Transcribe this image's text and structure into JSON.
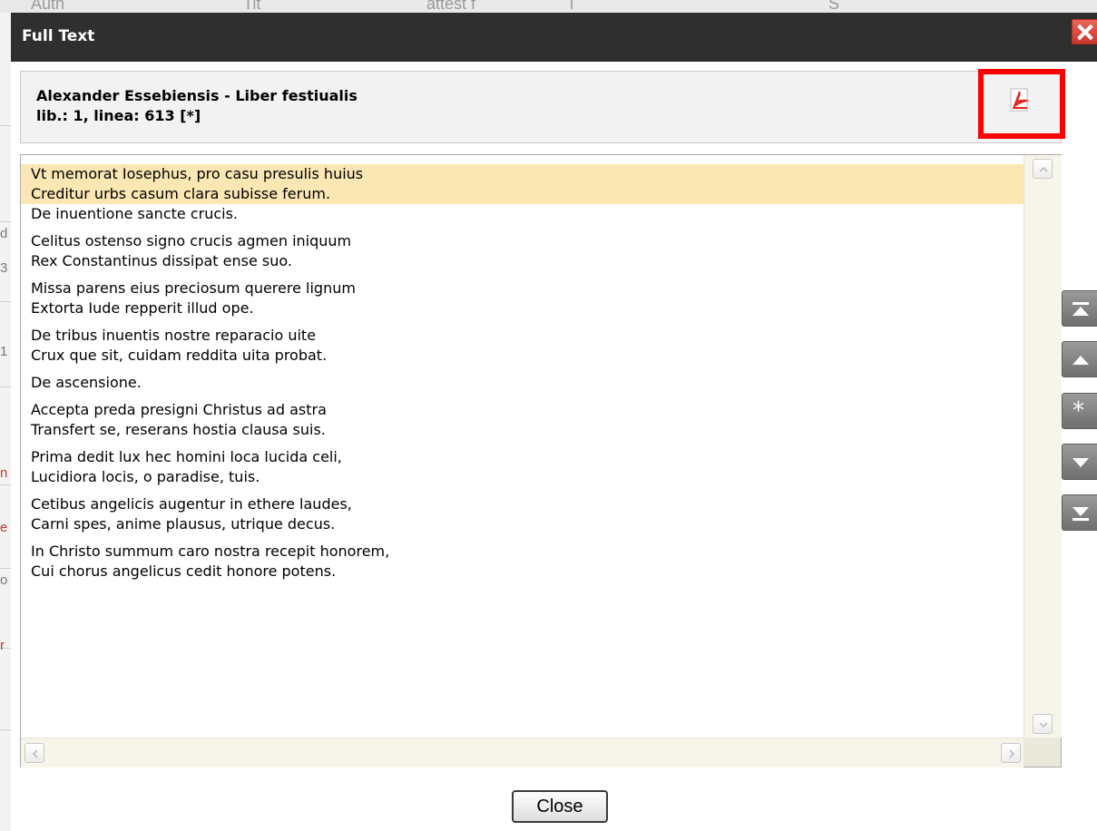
{
  "background": {
    "header_fragments": [
      "Auth",
      "Tit",
      "attest f",
      "l",
      "S"
    ]
  },
  "dialog": {
    "title": "Full Text",
    "close_icon": "close-x-icon",
    "header": {
      "line1": "Alexander Essebiensis - Liber festiualis",
      "line2": "lib.: 1, linea: 613 [*]",
      "pdf_icon": "pdf-icon"
    },
    "passages": [
      {
        "lines": [
          "Vt memorat Iosephus, pro casu presulis huius",
          "Creditur urbs casum clara subisse ferum."
        ],
        "highlighted": true
      },
      {
        "lines": [
          "De inuentione sancte crucis."
        ],
        "highlighted": false
      },
      {
        "lines": [
          "Celitus ostenso signo crucis agmen iniquum",
          "Rex Constantinus dissipat ense suo."
        ],
        "highlighted": false
      },
      {
        "lines": [
          "Missa parens eius preciosum querere lignum",
          "Extorta Iude repperit illud ope."
        ],
        "highlighted": false
      },
      {
        "lines": [
          "De tribus inuentis nostre reparacio uite",
          "Crux que sit, cuidam reddita uita probat."
        ],
        "highlighted": false
      },
      {
        "lines": [
          "De ascensione."
        ],
        "highlighted": false
      },
      {
        "lines": [
          "Accepta preda presigni Christus ad astra",
          "Transfert se, reserans hostia clausa suis."
        ],
        "highlighted": false
      },
      {
        "lines": [
          "Prima dedit lux hec homini loca lucida celi,",
          "Lucidiora locis, o paradise, tuis."
        ],
        "highlighted": false
      },
      {
        "lines": [
          "Cetibus angelicis augentur in ethere laudes,",
          "Carni spes, anime plausus, utrique decus."
        ],
        "highlighted": false
      },
      {
        "lines": [
          "In Christo summum caro nostra recepit honorem,",
          "Cui chorus angelicus cedit honore potens."
        ],
        "highlighted": false
      }
    ],
    "nav_buttons": [
      {
        "name": "first",
        "icon": "first-icon"
      },
      {
        "name": "prev",
        "icon": "up-arrow-icon"
      },
      {
        "name": "current",
        "icon": "asterisk-icon",
        "glyph": "*"
      },
      {
        "name": "next",
        "icon": "down-arrow-icon"
      },
      {
        "name": "last",
        "icon": "last-icon"
      }
    ],
    "close_button": "Close",
    "colors": {
      "titlebar": "#2f2f2f",
      "highlight": "#fbe7b4",
      "pdf_frame": "#ff0000",
      "close_x": "#d9473b"
    }
  }
}
